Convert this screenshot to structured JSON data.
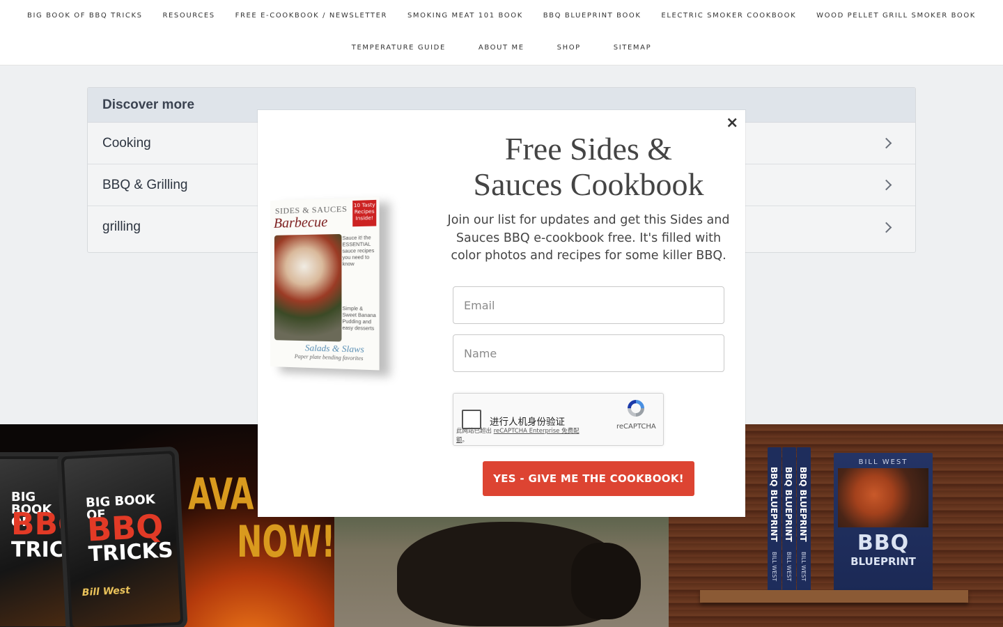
{
  "nav": {
    "row1": [
      "BIG BOOK OF BBQ TRICKS",
      "RESOURCES",
      "FREE E-COOKBOOK / NEWSLETTER",
      "SMOKING MEAT 101 BOOK",
      "BBQ BLUEPRINT BOOK",
      "ELECTRIC SMOKER COOKBOOK",
      "WOOD PELLET GRILL SMOKER BOOK"
    ],
    "row2": [
      "TEMPERATURE GUIDE",
      "ABOUT ME",
      "SHOP",
      "SITEMAP"
    ]
  },
  "discover": {
    "title": "Discover more",
    "items": [
      "Cooking",
      "BBQ & Grilling",
      "grilling"
    ]
  },
  "modal": {
    "close_symbol": "×",
    "title_line1": "Free Sides &",
    "title_line2": "Sauces Cookbook",
    "description": "Join our list for updates and get this Sides and Sauces BBQ e-cookbook free. It's filled with color photos and recipes for some killer BBQ.",
    "email_placeholder": "Email",
    "name_placeholder": "Name",
    "cta_label": "YES - GIVE ME THE COOKBOOK!",
    "book": {
      "top_label": "SIDES & SAUCES",
      "title": "Barbecue",
      "badge": "10 Tasty Recipes Inside!",
      "side_text": "Sauce it! the ESSENTIAL sauce recipes you need to know",
      "side_text2": "Simple & Sweet Banana Pudding and easy desserts",
      "bottom_title": "Salads & Slaws",
      "bottom_sub": "Paper plate bending favorites"
    }
  },
  "captcha": {
    "label": "进行人机身份验证",
    "notice_prefix": "此网站已超出 ",
    "notice_link": "reCAPTCHA Enterprise 免费配额",
    "notice_suffix": "。",
    "brand": "reCAPTCHA"
  },
  "banners": {
    "b1_big": "BIG BOOK OF",
    "b1_bbq": "BBQ",
    "b1_tricks": "TRICKS",
    "b1_author": "Bill West",
    "b1_avail": "AVA",
    "b1_now": "NOW!",
    "b3_spine": "BBQ BLUEPRINT",
    "b3_spine_author": "BILL WEST",
    "b3_author": "BILL WEST",
    "b3_title": "BBQ",
    "b3_sub": "BLUEPRINT"
  },
  "colors": {
    "cta": "#dd4432",
    "discover_header": "#dfe4ea",
    "nav_bg": "#ffffff"
  }
}
